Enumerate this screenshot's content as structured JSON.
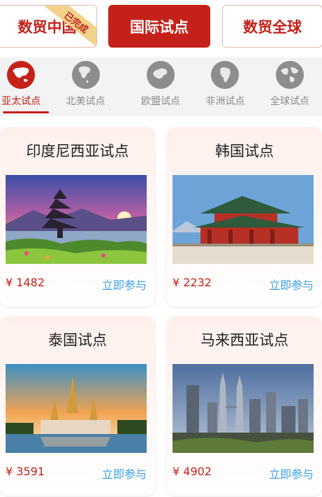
{
  "top_tabs": {
    "left": {
      "label": "数贸中国",
      "ribbon": "已完成"
    },
    "mid": {
      "label": "国际试点"
    },
    "right": {
      "label": "数贸全球"
    }
  },
  "regions": [
    {
      "label": "亚太试点",
      "icon": "asia-globe-icon",
      "active": true
    },
    {
      "label": "北美试点",
      "icon": "north-america-globe-icon",
      "active": false
    },
    {
      "label": "欧盟试点",
      "icon": "europe-globe-icon",
      "active": false
    },
    {
      "label": "非洲试点",
      "icon": "africa-globe-icon",
      "active": false
    },
    {
      "label": "全球试点",
      "icon": "world-globe-icon",
      "active": false
    }
  ],
  "cards": [
    {
      "title": "印度尼西亚试点",
      "price": "¥ 1482",
      "join": "立即参与",
      "image": "bali-temple-photo"
    },
    {
      "title": "韩国试点",
      "price": "¥ 2232",
      "join": "立即参与",
      "image": "korea-palace-photo"
    },
    {
      "title": "泰国试点",
      "price": "¥ 3591",
      "join": "立即参与",
      "image": "thailand-temple-photo"
    },
    {
      "title": "马来西亚试点",
      "price": "¥ 4902",
      "join": "立即参与",
      "image": "kuala-lumpur-skyline-photo"
    }
  ],
  "colors": {
    "accent": "#c4211a",
    "link": "#3aa0e6",
    "inactive": "#8d8d8d"
  }
}
